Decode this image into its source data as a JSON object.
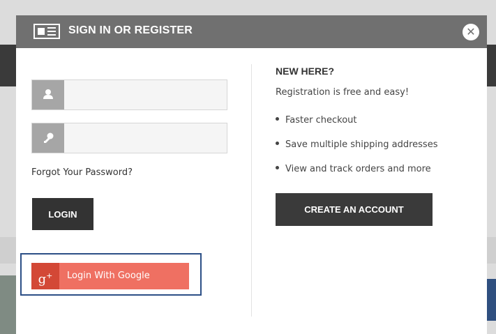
{
  "modal": {
    "title": "SIGN IN OR REGISTER",
    "close_symbol": "✕"
  },
  "login": {
    "username_placeholder": "",
    "password_placeholder": "",
    "forgot_password": "Forgot Your Password?",
    "login_button": "LOGIN",
    "google_icon_text": "g",
    "google_icon_plus": "+",
    "google_button": "Login With Google"
  },
  "register": {
    "title": "NEW HERE?",
    "subtitle": "Registration is free and easy!",
    "benefits": [
      "Faster checkout",
      "Save multiple shipping addresses",
      "View and track orders and more"
    ],
    "create_button": "CREATE AN ACCOUNT"
  },
  "icons": {
    "header": "id-card-icon",
    "user_field": "user-icon",
    "password_field": "key-icon",
    "google": "google-plus-icon",
    "close": "close-icon"
  },
  "colors": {
    "header_bg": "#707070",
    "dark_button": "#333333",
    "google_button": "#ef7062",
    "google_icon_bg": "#d34836",
    "highlight_outline": "#2c4f86"
  }
}
